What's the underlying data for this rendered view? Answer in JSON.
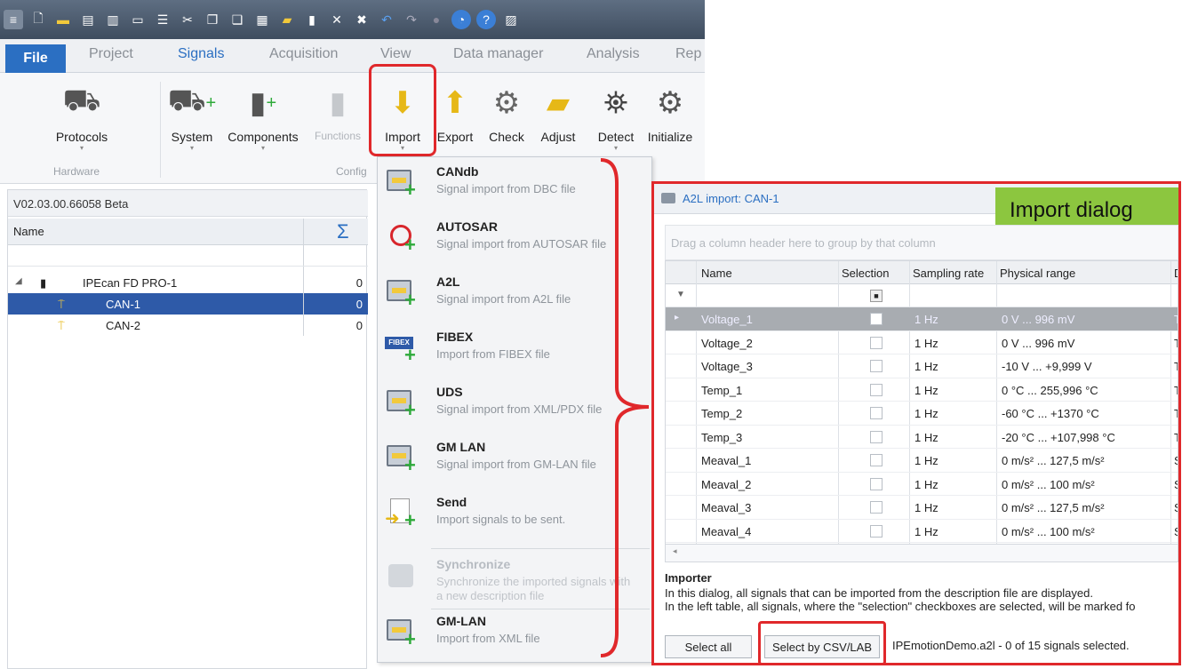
{
  "colors": {
    "accent": "#2b6fc2",
    "highlight": "#e0282b",
    "badge": "#8cc63f",
    "selection": "#2e5aa8"
  },
  "tabs": {
    "file": "File",
    "project": "Project",
    "signals": "Signals",
    "acquisition": "Acquisition",
    "view": "View",
    "data_manager": "Data manager",
    "analysis": "Analysis",
    "rep": "Rep"
  },
  "ribbon": {
    "protocols": "Protocols",
    "system": "System",
    "components": "Components",
    "functions": "Functions",
    "import": "Import",
    "export": "Export",
    "check": "Check",
    "adjust": "Adjust",
    "detect": "Detect",
    "initialize": "Initialize",
    "group_hardware": "Hardware",
    "group_config": "Config"
  },
  "left": {
    "version": "V02.03.00.66058 Beta",
    "col_name": "Name",
    "sigma": "Σ",
    "rows": [
      {
        "name": "IPEcan FD PRO-1",
        "value": "0"
      },
      {
        "name": "CAN-1",
        "value": "0"
      },
      {
        "name": "CAN-2",
        "value": "0"
      }
    ]
  },
  "menu": [
    {
      "title": "CANdb",
      "desc": "Signal import from DBC file"
    },
    {
      "title": "AUTOSAR",
      "desc": "Signal import from AUTOSAR file"
    },
    {
      "title": "A2L",
      "desc": "Signal import from A2L file"
    },
    {
      "title": "FIBEX",
      "desc": "Import from FIBEX file"
    },
    {
      "title": "UDS",
      "desc": "Signal import from XML/PDX file"
    },
    {
      "title": "GM LAN",
      "desc": "Signal import from GM-LAN file"
    },
    {
      "title": "Send",
      "desc": "Import signals to be sent."
    },
    {
      "title": "Synchronize",
      "desc": "Synchronize the imported signals with",
      "desc2": "a new description file"
    },
    {
      "title": "GM-LAN",
      "desc": "Import from XML file"
    }
  ],
  "dialog": {
    "title": "A2L import: CAN-1",
    "badge": "Import dialog",
    "group_hint": "Drag a column header here to group by that column",
    "columns": {
      "name": "Name",
      "selection": "Selection",
      "rate": "Sampling rate",
      "range": "Physical range",
      "d": "D"
    },
    "rows": [
      {
        "name": "Voltage_1",
        "rate": "1 Hz",
        "range": "0 V ... 996 mV",
        "d": "T"
      },
      {
        "name": "Voltage_2",
        "rate": "1 Hz",
        "range": "0 V ... 996 mV",
        "d": "T"
      },
      {
        "name": "Voltage_3",
        "rate": "1 Hz",
        "range": "-10 V ... +9,999 V",
        "d": "T"
      },
      {
        "name": "Temp_1",
        "rate": "1 Hz",
        "range": "0 °C ... 255,996 °C",
        "d": "T"
      },
      {
        "name": "Temp_2",
        "rate": "1 Hz",
        "range": "-60 °C ... +1370 °C",
        "d": "T"
      },
      {
        "name": "Temp_3",
        "rate": "1 Hz",
        "range": "-20 °C ... +107,998 °C",
        "d": "T"
      },
      {
        "name": "Meaval_1",
        "rate": "1 Hz",
        "range": "0 m/s² ... 127,5 m/s²",
        "d": "S"
      },
      {
        "name": "Meaval_2",
        "rate": "1 Hz",
        "range": "0 m/s² ... 100 m/s²",
        "d": "S"
      },
      {
        "name": "Meaval_3",
        "rate": "1 Hz",
        "range": "0 m/s² ... 127,5 m/s²",
        "d": "S"
      },
      {
        "name": "Meaval_4",
        "rate": "1 Hz",
        "range": "0 m/s² ... 100 m/s²",
        "d": "S"
      }
    ],
    "importer_title": "Importer",
    "importer_line1": "In this dialog, all signals that can be imported from the description file are displayed.",
    "importer_line2": "In the left table, all signals, where the \"selection\" checkboxes are selected, will be marked fo",
    "select_all": "Select all",
    "select_csv": "Select by CSV/LAB",
    "status": "IPEmotionDemo.a2l  -  0 of 15 signals selected."
  }
}
